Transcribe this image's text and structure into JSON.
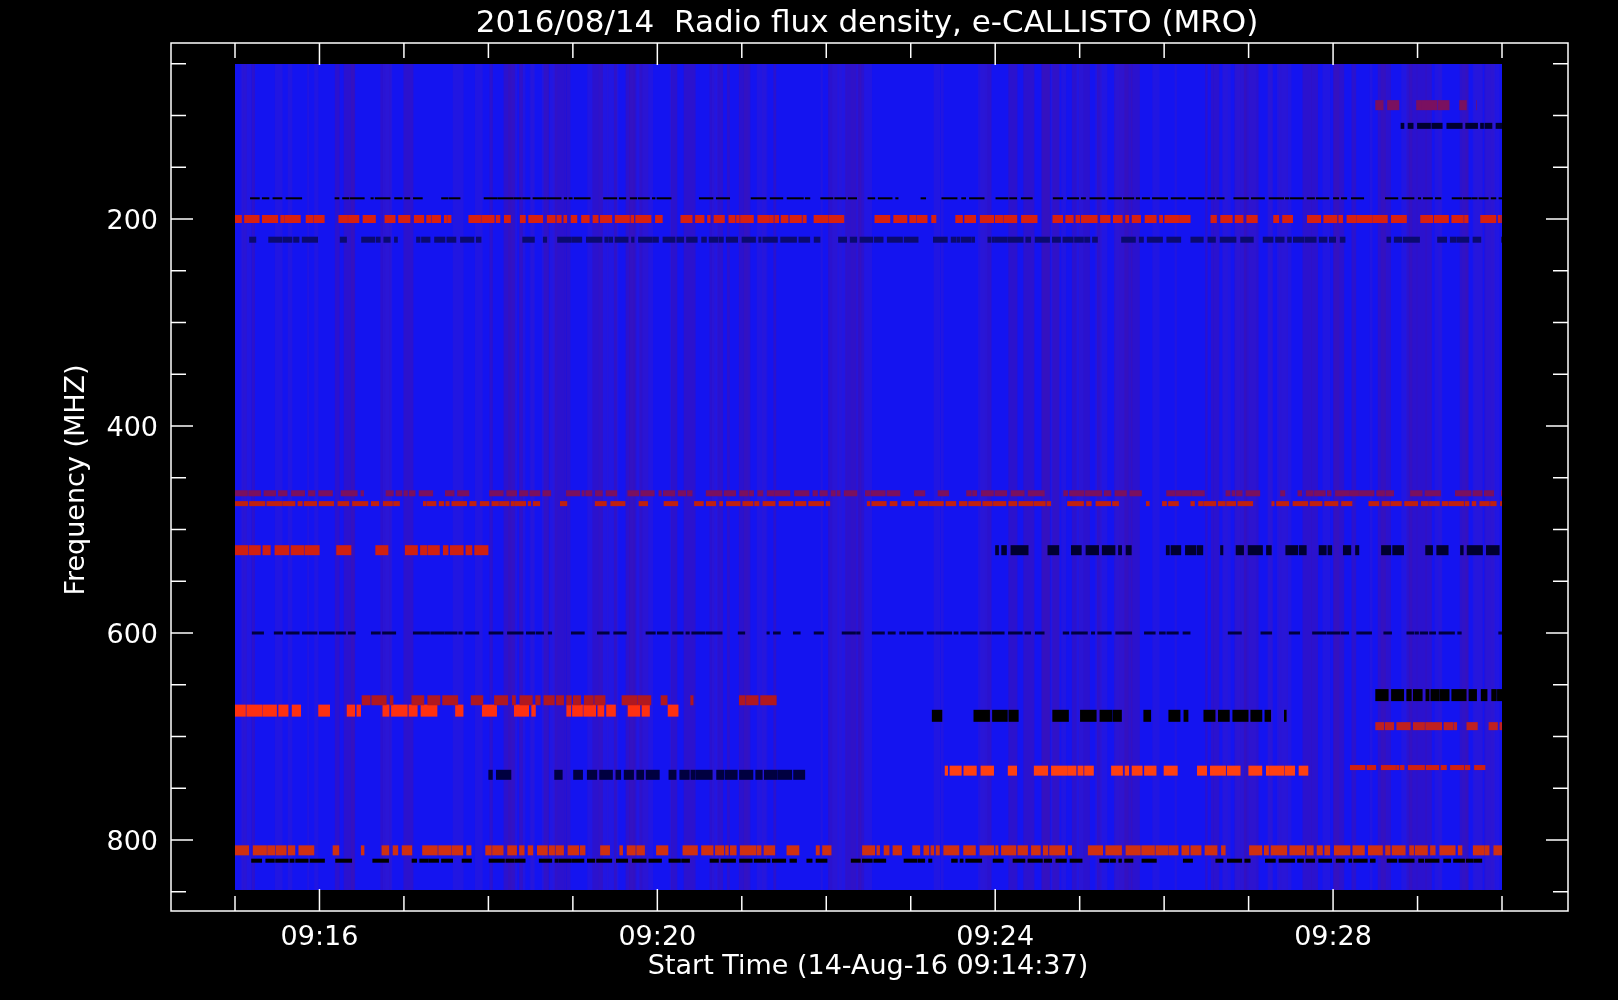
{
  "title": "2016/08/14  Radio flux density, e-CALLISTO (MRO)",
  "ylabel": "Frequency (MHZ)",
  "xlabel": "Start Time (14-Aug-16 09:14:37)",
  "yticks": [
    "200",
    "400",
    "600",
    "800"
  ],
  "xticks": [
    "09:16",
    "09:20",
    "09:24",
    "09:28"
  ]
}
